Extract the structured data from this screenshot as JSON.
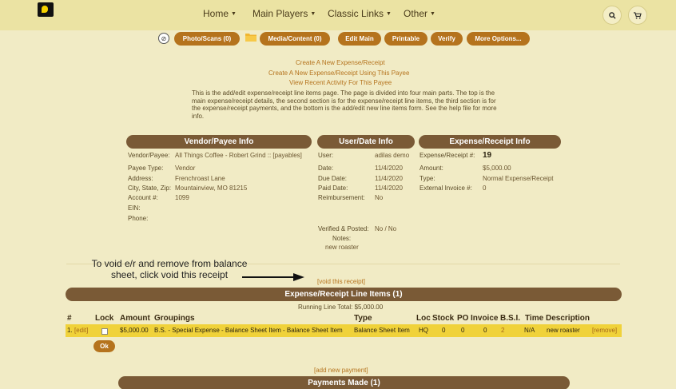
{
  "nav": {
    "items": [
      "Home",
      "Main Players",
      "Classic Links",
      "Other"
    ]
  },
  "toolbar": {
    "photo": "Photo/Scans (0)",
    "media": "Media/Content (0)",
    "edit": "Edit Main",
    "printable": "Printable",
    "verify": "Verify",
    "more": "More Options..."
  },
  "links": {
    "create": "Create A New Expense/Receipt",
    "create_payee": "Create A New Expense/Receipt Using This Payee",
    "recent": "View Recent Activity For This Payee"
  },
  "description": "This is the add/edit expense/receipt line items page. The page is divided into four main parts. The top is the main expense/receipt details, the second section is for the expense/receipt line items, the third section is for the expense/receipt payments, and the bottom is the add/edit new line items form. See the help file for more info.",
  "vendor": {
    "heading": "Vendor/Payee Info",
    "payee_label": "Vendor/Payee:",
    "payee_value": "All Things Coffee - Robert Grind :: [payables]",
    "type_label": "Payee Type:",
    "type_value": "Vendor",
    "address_label": "Address:",
    "address_value": "Frenchroast Lane",
    "city_label": "City, State, Zip:",
    "city_value": "Mountainview, MO 81215",
    "account_label": "Account #:",
    "account_value": "1099",
    "ein_label": "EIN:",
    "phone_label": "Phone:"
  },
  "userdate": {
    "heading": "User/Date Info",
    "user_label": "User:",
    "user_value": "adilas demo",
    "date_label": "Date:",
    "date_value": "11/4/2020",
    "due_label": "Due Date:",
    "due_value": "11/4/2020",
    "paid_label": "Paid Date:",
    "paid_value": "11/4/2020",
    "reimb_label": "Reimbursement:",
    "reimb_value": "No",
    "verified_label": "Verified & Posted:",
    "verified_value": "No / No",
    "notes_label": "Notes:",
    "notes_value": "new roaster"
  },
  "expense": {
    "heading": "Expense/Receipt Info",
    "num_label": "Expense/Receipt #:",
    "num_value": "19",
    "amount_label": "Amount:",
    "amount_value": "$5,000.00",
    "type_label": "Type:",
    "type_value": "Normal Expense/Receipt",
    "ext_label": "External Invoice #:",
    "ext_value": "0"
  },
  "annotation": {
    "line1": "To void e/r and remove from balance",
    "line2": "sheet, click void this receipt"
  },
  "void_link": "[void this receipt]",
  "line_items": {
    "heading": "Expense/Receipt Line Items (1)",
    "running_total": "Running Line Total: $5,000.00",
    "columns": [
      "#",
      "Lock",
      "Amount",
      "Groupings",
      "Type",
      "Loc",
      "Stock",
      "PO",
      "Invoice",
      "B.S.I.",
      "Time",
      "Description"
    ],
    "row": {
      "num": "1.",
      "edit": "[edit]",
      "amount": "$5,000.00",
      "grouping": "B.S. - Special Expense - Balance Sheet Item - Balance Sheet Item",
      "type": "Balance Sheet Item",
      "loc": "HQ",
      "stock": "0",
      "po": "0",
      "invoice": "0",
      "bsi": "2",
      "time": "N/A",
      "description": "new roaster",
      "remove": "[remove]"
    },
    "ok": "Ok"
  },
  "add_payment": "[add new payment]",
  "payments": {
    "heading": "Payments Made (1)"
  },
  "icons": {
    "search": "search-icon",
    "cart": "cart-icon"
  },
  "colors": {
    "accent": "#b5731d",
    "header": "#7a5a36",
    "topbar": "#ebe3a3",
    "background": "#f1ebc5",
    "highlight": "#f0d23a"
  }
}
